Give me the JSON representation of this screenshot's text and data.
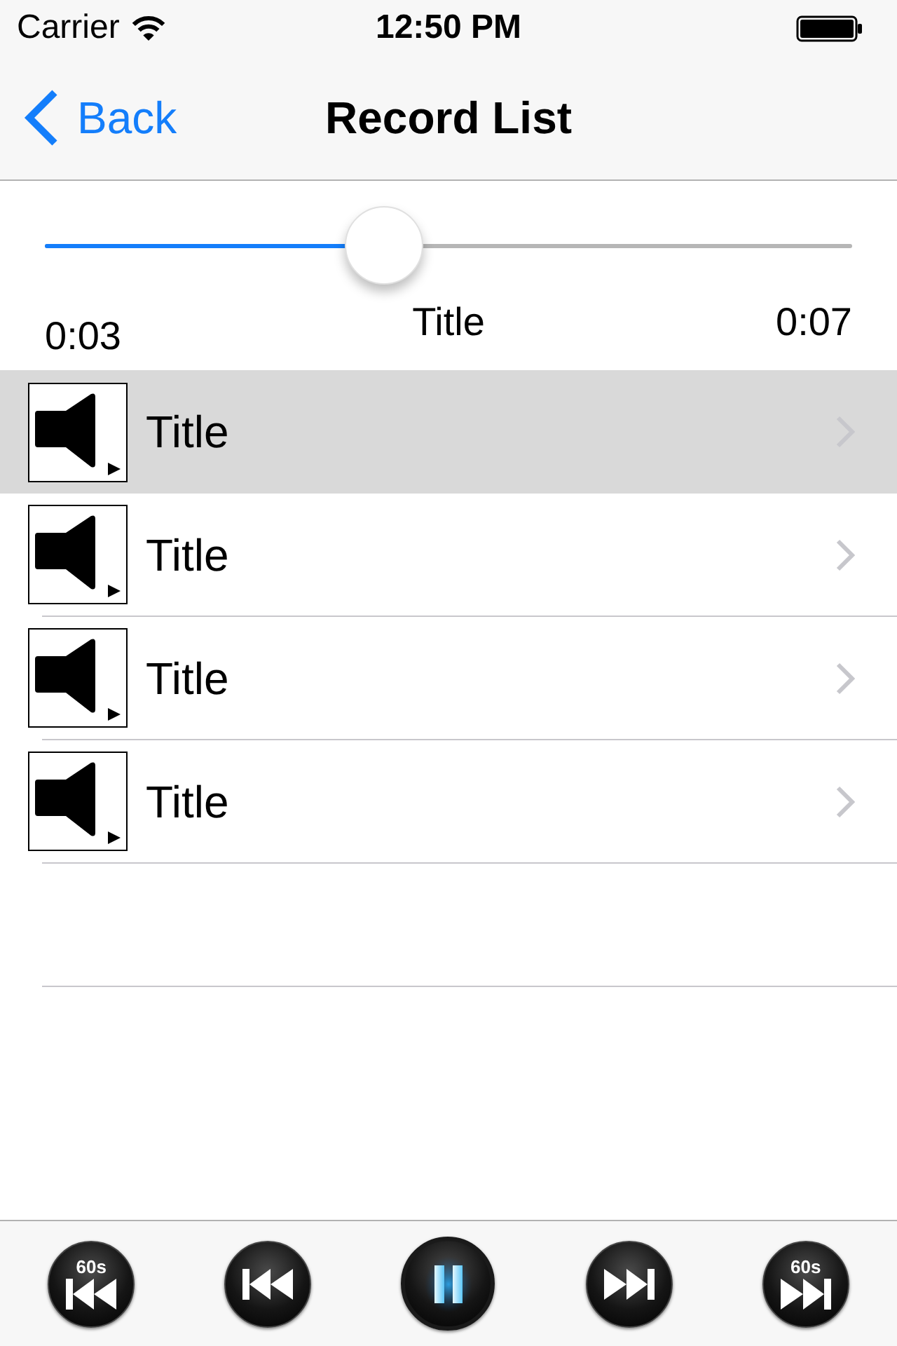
{
  "status_bar": {
    "carrier": "Carrier",
    "time": "12:50 PM"
  },
  "nav_bar": {
    "back": "Back",
    "title": "Record List"
  },
  "player": {
    "level": 0.42,
    "elapsed": "0:03",
    "title": "Title",
    "duration": "0:07"
  },
  "rows": [
    {
      "title": "Title",
      "selected": true
    },
    {
      "title": "Title",
      "selected": false
    },
    {
      "title": "Title",
      "selected": false
    },
    {
      "title": "Title",
      "selected": false
    }
  ],
  "toolbar": [
    {
      "kind": "skip_back",
      "label": "60s"
    },
    {
      "kind": "previous"
    },
    {
      "kind": "pause"
    },
    {
      "kind": "next"
    },
    {
      "kind": "skip_forward",
      "label": "60s"
    }
  ]
}
